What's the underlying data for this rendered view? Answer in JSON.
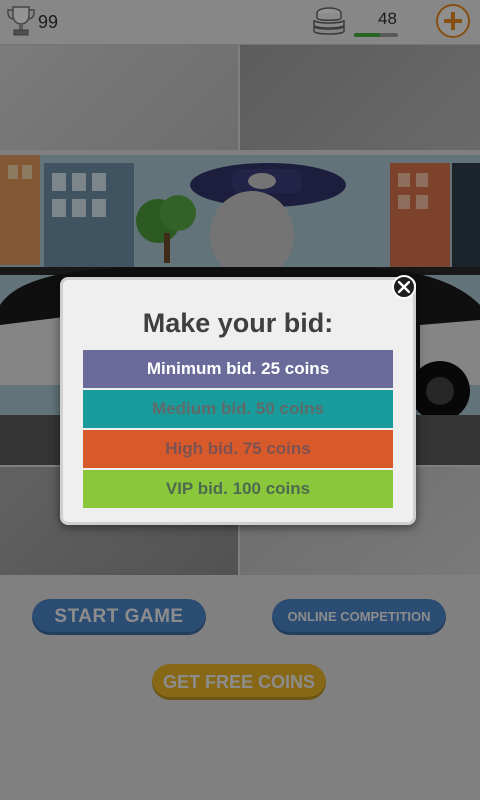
{
  "header": {
    "trophy_count": "99",
    "coin_count": "48",
    "coin_progress": 0.6,
    "icons": {
      "trophy": "trophy-icon",
      "coins": "coin-stack-icon",
      "add": "plus-icon"
    }
  },
  "modal": {
    "title": "Make your bid:",
    "options": [
      {
        "label": "Minimum bid. 25 coins",
        "color": "#6b6b9b",
        "text_color": "#ffffff"
      },
      {
        "label": "Medium bid. 50 coins",
        "color": "#1a9b9b",
        "text_color": "#5f6a6a"
      },
      {
        "label": "High bid. 75 coins",
        "color": "#d85a2a",
        "text_color": "#7c5252"
      },
      {
        "label": "VIP bid. 100 coins",
        "color": "#8ac73a",
        "text_color": "#4f6b4f"
      }
    ],
    "close_icon": "close-icon"
  },
  "menu": {
    "start": "START GAME",
    "online": "ONLINE COMPETITION",
    "free_coins": "GET FREE COINS"
  },
  "colors": {
    "accent_blue": "#4a83c6",
    "accent_gold": "#e7b429",
    "plus_orange": "#e58a1f"
  }
}
